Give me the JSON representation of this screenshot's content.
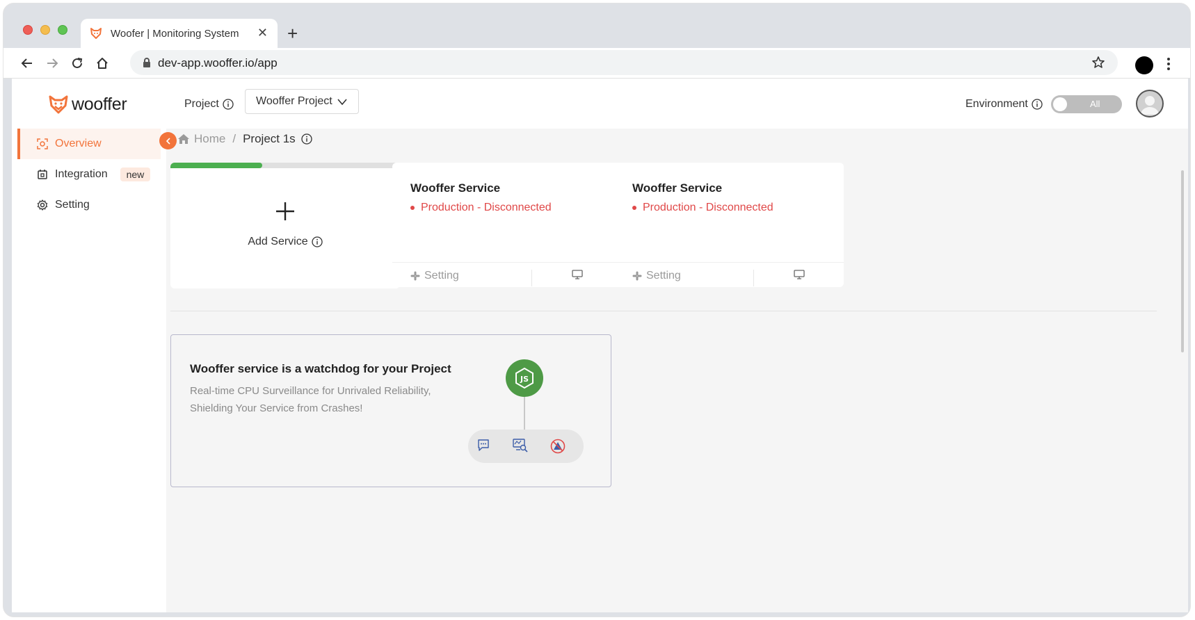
{
  "browser": {
    "tab_title": "Woofer | Monitoring System",
    "tab_close": "✕",
    "new_tab": "+",
    "url": "dev-app.wooffer.io/app"
  },
  "header": {
    "logo_text": "wooffer",
    "project_label": "Project",
    "project_selected": "Wooffer Project",
    "environment_label": "Environment",
    "environment_toggle": "All"
  },
  "sidebar": {
    "items": [
      {
        "label": "Overview",
        "icon": "overview-icon",
        "active": true
      },
      {
        "label": "Integration",
        "icon": "integration-icon",
        "badge": "new"
      },
      {
        "label": "Setting",
        "icon": "gear-icon"
      }
    ]
  },
  "breadcrumb": {
    "home": "Home",
    "separator": "/",
    "current": "Project 1s"
  },
  "add_card": {
    "label": "Add Service",
    "progress_percent": 40
  },
  "services": [
    {
      "title": "Wooffer Service",
      "status": "Production - Disconnected",
      "setting_label": "Setting"
    },
    {
      "title": "Wooffer Service",
      "status": "Production - Disconnected",
      "setting_label": "Setting"
    }
  ],
  "promo": {
    "title": "Wooffer service is a watchdog for your Project",
    "description": "Real-time CPU Surveillance for Unrivaled Reliability, Shielding Your Service from Crashes!"
  },
  "colors": {
    "accent": "#f2743b",
    "status_error": "#e04848",
    "progress": "#4caf50",
    "node_green": "#4e9a46"
  }
}
